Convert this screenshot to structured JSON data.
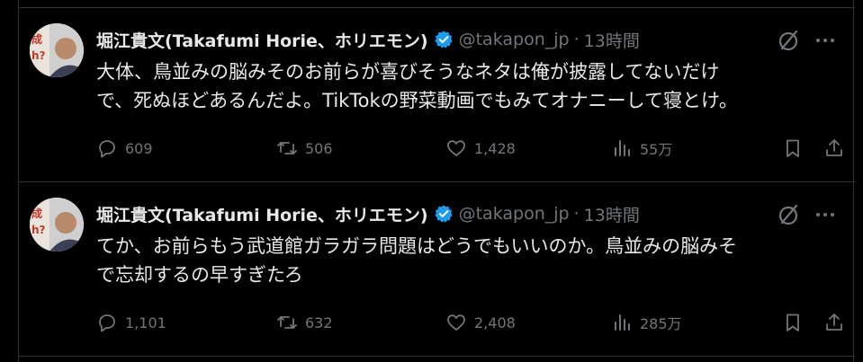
{
  "tweets": [
    {
      "display_name": "堀江貴文(Takafumi Horie、ホリエモン)",
      "handle": "@takapon_jp",
      "separator": "·",
      "time": "13時間",
      "text": "大体、鳥並みの脳みそのお前らが喜びそうなネタは俺が披露してないだけ\nで、死ぬほどあるんだよ。TikTokの野菜動画でもみてオナニーして寝とけ。",
      "replies": "609",
      "retweets": "506",
      "likes": "1,428",
      "views": "55万"
    },
    {
      "display_name": "堀江貴文(Takafumi Horie、ホリエモン)",
      "handle": "@takapon_jp",
      "separator": "·",
      "time": "13時間",
      "text": "てか、お前らもう武道館ガラガラ問題はどうでもいいのか。鳥並みの脳みそ\nで忘却するの早すぎたろ",
      "replies": "1,101",
      "retweets": "632",
      "likes": "2,408",
      "views": "285万"
    }
  ],
  "colors": {
    "background": "#000000",
    "text": "#e7e9ea",
    "muted": "#71767b",
    "verified": "#1d9bf0",
    "divider": "#2f3336"
  },
  "icons": {
    "verified": "verified-badge-icon",
    "grok": "grok-icon",
    "more": "more-icon",
    "reply": "reply-icon",
    "retweet": "retweet-icon",
    "like": "heart-icon",
    "views": "views-icon",
    "bookmark": "bookmark-icon",
    "share": "share-icon"
  }
}
